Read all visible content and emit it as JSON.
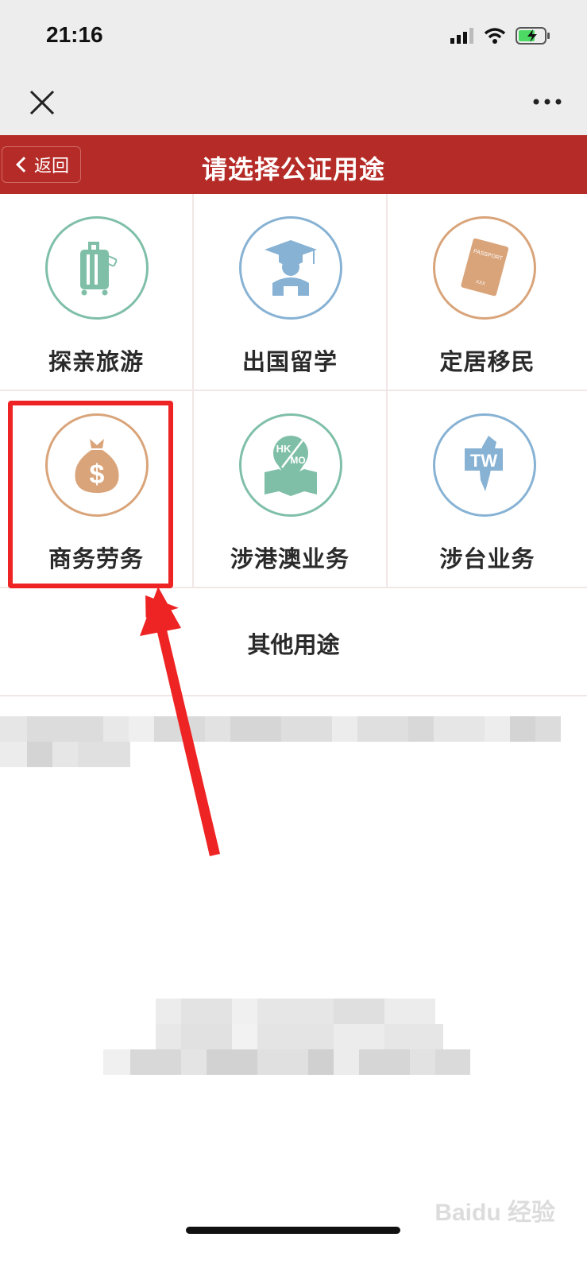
{
  "status_bar": {
    "time": "21:16"
  },
  "header": {
    "back_label": "返回",
    "title": "请选择公证用途"
  },
  "purposes": [
    {
      "label": "探亲旅游",
      "icon": "luggage-icon",
      "color": "#7fbfa8"
    },
    {
      "label": "出国留学",
      "icon": "graduate-icon",
      "color": "#87b2d4"
    },
    {
      "label": "定居移民",
      "icon": "passport-icon",
      "color": "#d9a47a"
    },
    {
      "label": "商务劳务",
      "icon": "money-bag-icon",
      "color": "#d9a47a"
    },
    {
      "label": "涉港澳业务",
      "icon": "hk-mo-map-icon",
      "color": "#7fbfa8"
    },
    {
      "label": "涉台业务",
      "icon": "taiwan-icon",
      "color": "#87b2d4"
    }
  ],
  "other_label": "其他用途",
  "passport_text": "PASSPORT",
  "passport_xxx": "XXX",
  "hk_label": "HK",
  "mo_label": "MO",
  "tw_label": "TW",
  "watermark": "Baidu 经验"
}
